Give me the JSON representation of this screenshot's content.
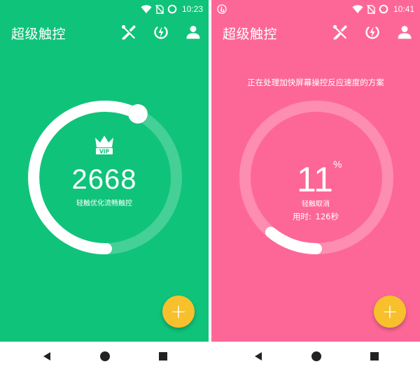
{
  "colors": {
    "green": "#10c37a",
    "pink": "#fd6797",
    "fab": "#f7c02c",
    "white": "#ffffff"
  },
  "left": {
    "status_time": "10:23",
    "app_title": "超级触控",
    "actions": [
      "tools-icon",
      "power-icon",
      "user-icon"
    ],
    "badge_text": "VIP",
    "score": "2668",
    "score_label": "轻触优化流畅触控",
    "fab_label": "+"
  },
  "right": {
    "status_time": "10:41",
    "app_title": "超级触控",
    "actions": [
      "tools-icon",
      "power-icon",
      "user-icon"
    ],
    "headline": "正在处理加快屏幕操控反应速度的方案",
    "progress_value": "11",
    "progress_unit": "%",
    "progress_fraction": 0.11,
    "cancel_label": "轻触取消",
    "elapsed_label": "用时:",
    "elapsed_value": "126秒",
    "fab_label": "+"
  }
}
